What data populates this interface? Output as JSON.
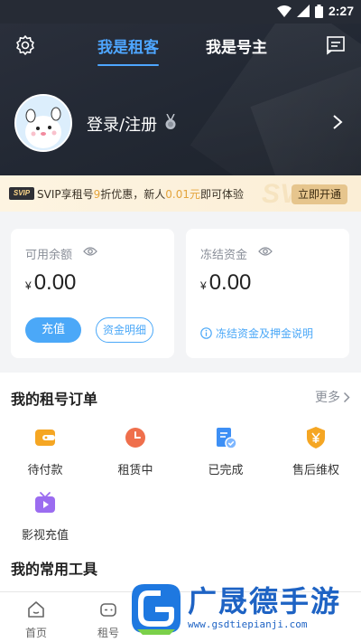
{
  "status_bar": {
    "time": "2:27"
  },
  "header": {
    "tabs": [
      {
        "label": "我是租客",
        "active": true
      },
      {
        "label": "我是号主",
        "active": false
      }
    ],
    "login_label": "登录/注册"
  },
  "svip_banner": {
    "badge": "SVIP",
    "text_before": "SVIP享租号",
    "discount": "9",
    "text_middle": "折优惠，新人",
    "price": "0.01元",
    "text_after": "即可体验",
    "watermark": "SVIP",
    "button": "立即开通"
  },
  "balance": {
    "available": {
      "label": "可用余额",
      "currency": "¥",
      "amount": "0.00",
      "recharge": "充值",
      "detail": "资金明细"
    },
    "frozen": {
      "label": "冻结资金",
      "currency": "¥",
      "amount": "0.00",
      "info_link": "冻结资金及押金说明"
    }
  },
  "orders": {
    "title": "我的租号订单",
    "more": "更多",
    "items": [
      {
        "label": "待付款",
        "icon": "wallet-icon",
        "color": "#f5a623"
      },
      {
        "label": "租赁中",
        "icon": "clock-icon",
        "color": "#ef6f4c"
      },
      {
        "label": "已完成",
        "icon": "completed-doc-icon",
        "color": "#3d8ff5"
      },
      {
        "label": "售后维权",
        "icon": "shield-yen-icon",
        "color": "#f5a623"
      },
      {
        "label": "影视充值",
        "icon": "tv-play-icon",
        "color": "#9b6cf0"
      }
    ]
  },
  "tools": {
    "title": "我的常用工具"
  },
  "bottom_nav": [
    {
      "label": "首页",
      "icon": "home-icon"
    },
    {
      "label": "租号",
      "icon": "gamepad-icon"
    }
  ],
  "watermark": {
    "title": "广晟德手游",
    "url": "www.gsdtiepianji.com"
  },
  "colors": {
    "accent": "#4ba8f8",
    "header_bg": "#242a35",
    "gold": "#e6c58d"
  }
}
